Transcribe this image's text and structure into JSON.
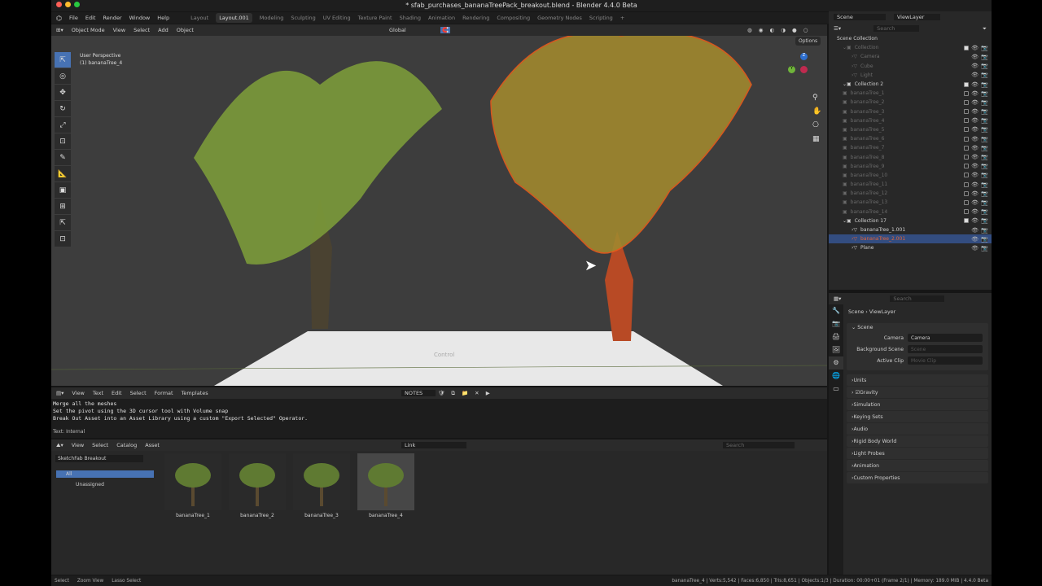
{
  "window": {
    "title": "* sfab_purchases_bananaTreePack_breakout.blend - Blender 4.4.0 Beta"
  },
  "menu": [
    "File",
    "Edit",
    "Render",
    "Window",
    "Help"
  ],
  "workspaces": [
    "Layout",
    "Layout.001",
    "Modeling",
    "Sculpting",
    "UV Editing",
    "Texture Paint",
    "Shading",
    "Animation",
    "Rendering",
    "Compositing",
    "Geometry Nodes",
    "Scripting",
    "+"
  ],
  "active_workspace": "Layout.001",
  "viewport": {
    "mode": "Object Mode",
    "menus": [
      "View",
      "Select",
      "Add",
      "Object"
    ],
    "orientation": "Global",
    "options": "Options",
    "perspective": "User Perspective",
    "object": "(1) bananaTree_4",
    "overlay_text": "Control",
    "gizmo": {
      "z": "Z",
      "y": "Y"
    }
  },
  "outliner": {
    "scene": "Scene",
    "view_layer": "ViewLayer",
    "search_placeholder": "Search",
    "root": "Scene Collection",
    "rows": [
      {
        "label": "Collection",
        "indent": 1,
        "dim": true,
        "chk": true
      },
      {
        "label": "Camera",
        "indent": 2,
        "dim": true
      },
      {
        "label": "Cube",
        "indent": 2,
        "dim": true
      },
      {
        "label": "Light",
        "indent": 2,
        "dim": true
      },
      {
        "label": "Collection 2",
        "indent": 1,
        "chk": true
      },
      {
        "label": "bananaTree_1",
        "indent": 1,
        "dim": true,
        "box": true
      },
      {
        "label": "bananaTree_2",
        "indent": 1,
        "dim": true,
        "box": true
      },
      {
        "label": "bananaTree_3",
        "indent": 1,
        "dim": true,
        "box": true
      },
      {
        "label": "bananaTree_4",
        "indent": 1,
        "dim": true,
        "box": true
      },
      {
        "label": "bananaTree_5",
        "indent": 1,
        "dim": true,
        "box": true
      },
      {
        "label": "bananaTree_6",
        "indent": 1,
        "dim": true,
        "box": true
      },
      {
        "label": "bananaTree_7",
        "indent": 1,
        "dim": true,
        "box": true
      },
      {
        "label": "bananaTree_8",
        "indent": 1,
        "dim": true,
        "box": true
      },
      {
        "label": "bananaTree_9",
        "indent": 1,
        "dim": true,
        "box": true
      },
      {
        "label": "bananaTree_10",
        "indent": 1,
        "dim": true,
        "box": true
      },
      {
        "label": "bananaTree_11",
        "indent": 1,
        "dim": true,
        "box": true
      },
      {
        "label": "bananaTree_12",
        "indent": 1,
        "dim": true,
        "box": true
      },
      {
        "label": "bananaTree_13",
        "indent": 1,
        "dim": true,
        "box": true
      },
      {
        "label": "bananaTree_14",
        "indent": 1,
        "dim": true,
        "box": true
      },
      {
        "label": "Collection 17",
        "indent": 1,
        "chk": true
      },
      {
        "label": "bananaTree_1.001",
        "indent": 2
      },
      {
        "label": "bananaTree_2.001",
        "indent": 2,
        "selected": true
      },
      {
        "label": "Plane",
        "indent": 2
      }
    ]
  },
  "properties": {
    "search_placeholder": "Search",
    "breadcrumb": [
      "Scene",
      "ViewLayer"
    ],
    "section": "Scene",
    "fields": [
      {
        "label": "Camera",
        "value": "Camera"
      },
      {
        "label": "Background Scene",
        "value": "Scene"
      },
      {
        "label": "Active Clip",
        "value": "Movie Clip"
      }
    ],
    "panels": [
      "Units",
      "Gravity",
      "Simulation",
      "Keying Sets",
      "Audio",
      "Rigid Body World",
      "Light Probes",
      "Animation",
      "Custom Properties"
    ]
  },
  "text_editor": {
    "menus": [
      "View",
      "Text",
      "Edit",
      "Select",
      "Format",
      "Templates"
    ],
    "file": "NOTES",
    "lines": [
      "Merge all the meshes",
      "Set the pivot using the 3D cursor tool with Volume snap",
      "Break Out Asset into an Asset Library using a custom \"Export Selected\" Operator."
    ],
    "footer": "Text: Internal"
  },
  "asset_browser": {
    "menus": [
      "View",
      "Select",
      "Catalog",
      "Asset"
    ],
    "import": "Link",
    "library": "SketchFab Breakout",
    "catalogs": [
      "All",
      "Unassigned"
    ],
    "search_placeholder": "Search",
    "assets": [
      "bananaTree_1",
      "bananaTree_2",
      "bananaTree_3",
      "bananaTree_4"
    ]
  },
  "status": {
    "left": [
      "Select",
      "Zoom View",
      "Lasso Select"
    ],
    "right": "bananaTree_4 | Verts:5,542 | Faces:6,850 | Tris:8,651 | Objects:1/3 | Duration: 00:00+01 (Frame 2/1) | Memory: 189.0 MiB | 4.4.0 Beta"
  }
}
